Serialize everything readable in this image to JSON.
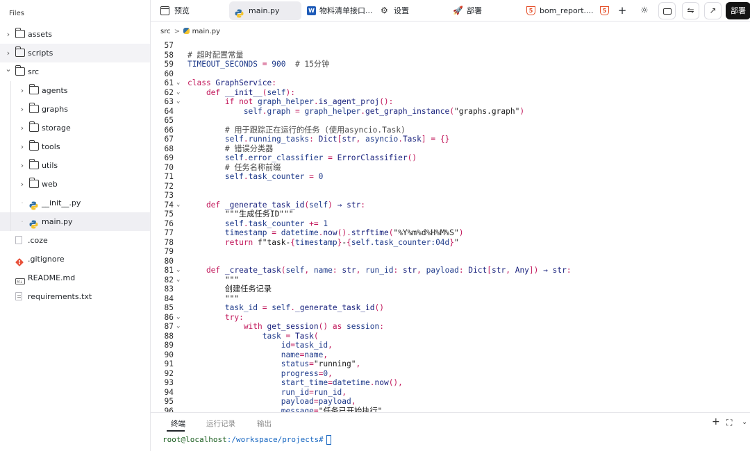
{
  "sidebar": {
    "title": "Files",
    "items": [
      {
        "label": "assets",
        "type": "folder",
        "depth": 0,
        "expanded": false
      },
      {
        "label": "scripts",
        "type": "folder",
        "depth": 0,
        "expanded": false
      },
      {
        "label": "src",
        "type": "folder",
        "depth": 0,
        "expanded": true
      },
      {
        "label": "agents",
        "type": "folder",
        "depth": 1,
        "expanded": false
      },
      {
        "label": "graphs",
        "type": "folder",
        "depth": 1,
        "expanded": false
      },
      {
        "label": "storage",
        "type": "folder",
        "depth": 1,
        "expanded": false
      },
      {
        "label": "tools",
        "type": "folder",
        "depth": 1,
        "expanded": false
      },
      {
        "label": "utils",
        "type": "folder",
        "depth": 1,
        "expanded": false
      },
      {
        "label": "web",
        "type": "folder",
        "depth": 1,
        "expanded": false
      },
      {
        "label": "__init__.py",
        "type": "python",
        "depth": 1
      },
      {
        "label": "main.py",
        "type": "python",
        "depth": 1
      },
      {
        "label": ".coze",
        "type": "file",
        "depth": 0
      },
      {
        "label": ".gitignore",
        "type": "git",
        "depth": 0
      },
      {
        "label": "README.md",
        "type": "markdown",
        "depth": 0
      },
      {
        "label": "requirements.txt",
        "type": "text",
        "depth": 0
      }
    ]
  },
  "tabs": [
    {
      "label": "预览",
      "icon": "preview-icon"
    },
    {
      "label": "main.py",
      "icon": "python-icon",
      "active": true
    },
    {
      "label": "物料清单接口...",
      "icon": "word-icon"
    },
    {
      "label": "设置",
      "icon": "settings-sliders-icon"
    },
    {
      "label": "部署",
      "icon": "rocket-icon"
    },
    {
      "label": "bom_report....",
      "icon": "html5-icon"
    }
  ],
  "toolbar": {
    "add": "+",
    "deploy": "部署"
  },
  "breadcrumb": {
    "root": "src",
    "sep": ">",
    "file": "main.py"
  },
  "code_lines": [
    {
      "n": 57,
      "fold": "",
      "parts": []
    },
    {
      "n": 58,
      "fold": "",
      "parts": [
        [
          "# 超时配置常量",
          "com"
        ]
      ]
    },
    {
      "n": 59,
      "fold": "",
      "parts": [
        [
          "TIMEOUT_SECONDS",
          "var"
        ],
        [
          " = ",
          "pun"
        ],
        [
          "900",
          "num"
        ],
        [
          "  # 15分钟",
          "com"
        ]
      ]
    },
    {
      "n": 60,
      "fold": "",
      "parts": []
    },
    {
      "n": 61,
      "fold": "v",
      "parts": [
        [
          "class ",
          "kw"
        ],
        [
          "GraphService",
          "cls"
        ],
        [
          ":",
          "pun"
        ]
      ]
    },
    {
      "n": 62,
      "fold": "v",
      "parts": [
        [
          "    def ",
          "kw"
        ],
        [
          "__init__",
          "fn"
        ],
        [
          "(",
          "pun"
        ],
        [
          "self",
          "p"
        ],
        [
          "):",
          "pun"
        ]
      ]
    },
    {
      "n": 63,
      "fold": "v",
      "parts": [
        [
          "        if not ",
          "kw"
        ],
        [
          "graph_helper",
          "var"
        ],
        [
          ".",
          "pun"
        ],
        [
          "is_agent_proj",
          "fn"
        ],
        [
          "():",
          "pun"
        ]
      ]
    },
    {
      "n": 64,
      "fold": "",
      "parts": [
        [
          "            self",
          "p"
        ],
        [
          ".",
          "pun"
        ],
        [
          "graph",
          "var"
        ],
        [
          " = ",
          "pun"
        ],
        [
          "graph_helper",
          "var"
        ],
        [
          ".",
          "pun"
        ],
        [
          "get_graph_instance",
          "fn"
        ],
        [
          "(",
          "pun"
        ],
        [
          "\"graphs.graph\"",
          "str"
        ],
        [
          ")",
          "pun"
        ]
      ]
    },
    {
      "n": 65,
      "fold": "",
      "parts": []
    },
    {
      "n": 66,
      "fold": "",
      "parts": [
        [
          "        # 用于跟踪正在运行的任务 (使用asyncio.Task)",
          "com"
        ]
      ]
    },
    {
      "n": 67,
      "fold": "",
      "parts": [
        [
          "        self",
          "p"
        ],
        [
          ".",
          "pun"
        ],
        [
          "running_tasks",
          "var"
        ],
        [
          ": ",
          "pun"
        ],
        [
          "Dict",
          "cls"
        ],
        [
          "[",
          "pun"
        ],
        [
          "str",
          "cls"
        ],
        [
          ", ",
          "pun"
        ],
        [
          "asyncio",
          "var"
        ],
        [
          ".",
          "pun"
        ],
        [
          "Task",
          "cls"
        ],
        [
          "] = {}",
          "pun"
        ]
      ]
    },
    {
      "n": 68,
      "fold": "",
      "parts": [
        [
          "        # 错误分类器",
          "com"
        ]
      ]
    },
    {
      "n": 69,
      "fold": "",
      "parts": [
        [
          "        self",
          "p"
        ],
        [
          ".",
          "pun"
        ],
        [
          "error_classifier",
          "var"
        ],
        [
          " = ",
          "pun"
        ],
        [
          "ErrorClassifier",
          "cls"
        ],
        [
          "()",
          "pun"
        ]
      ]
    },
    {
      "n": 70,
      "fold": "",
      "parts": [
        [
          "        # 任务名称前缀",
          "com"
        ]
      ]
    },
    {
      "n": 71,
      "fold": "",
      "parts": [
        [
          "        self",
          "p"
        ],
        [
          ".",
          "pun"
        ],
        [
          "task_counter",
          "var"
        ],
        [
          " = ",
          "pun"
        ],
        [
          "0",
          "num"
        ]
      ]
    },
    {
      "n": 72,
      "fold": "",
      "parts": []
    },
    {
      "n": 73,
      "fold": "",
      "parts": []
    },
    {
      "n": 74,
      "fold": "v",
      "parts": [
        [
          "    def ",
          "kw"
        ],
        [
          "_generate_task_id",
          "fn"
        ],
        [
          "(",
          "pun"
        ],
        [
          "self",
          "p"
        ],
        [
          ") ",
          "pun"
        ],
        [
          "→",
          "cls"
        ],
        [
          " str",
          "cls"
        ],
        [
          ":",
          "pun"
        ]
      ]
    },
    {
      "n": 75,
      "fold": "",
      "parts": [
        [
          "        \"\"\"生成任务ID\"\"\"",
          "str"
        ]
      ]
    },
    {
      "n": 76,
      "fold": "",
      "parts": [
        [
          "        self",
          "p"
        ],
        [
          ".",
          "pun"
        ],
        [
          "task_counter",
          "var"
        ],
        [
          " += ",
          "pun"
        ],
        [
          "1",
          "num"
        ]
      ]
    },
    {
      "n": 77,
      "fold": "",
      "parts": [
        [
          "        timestamp",
          "var"
        ],
        [
          " = ",
          "pun"
        ],
        [
          "datetime",
          "var"
        ],
        [
          ".",
          "pun"
        ],
        [
          "now",
          "fn"
        ],
        [
          "().",
          "pun"
        ],
        [
          "strftime",
          "fn"
        ],
        [
          "(",
          "pun"
        ],
        [
          "\"%Y%m%d%H%M%S\"",
          "str"
        ],
        [
          ")",
          "pun"
        ]
      ]
    },
    {
      "n": 78,
      "fold": "",
      "parts": [
        [
          "        return ",
          "kw"
        ],
        [
          "f\"task-",
          "str"
        ],
        [
          "{",
          "pun"
        ],
        [
          "timestamp",
          "var"
        ],
        [
          "}",
          "pun"
        ],
        [
          "-",
          "str"
        ],
        [
          "{",
          "pun"
        ],
        [
          "self.task_counter:04d",
          "var"
        ],
        [
          "}",
          "pun"
        ],
        [
          "\"",
          "str"
        ]
      ]
    },
    {
      "n": 79,
      "fold": "",
      "parts": []
    },
    {
      "n": 80,
      "fold": "",
      "parts": []
    },
    {
      "n": 81,
      "fold": "v",
      "parts": [
        [
          "    def ",
          "kw"
        ],
        [
          "_create_task",
          "fn"
        ],
        [
          "(",
          "pun"
        ],
        [
          "self",
          "p"
        ],
        [
          ", ",
          "pun"
        ],
        [
          "name",
          "var"
        ],
        [
          ": ",
          "pun"
        ],
        [
          "str",
          "cls"
        ],
        [
          ", ",
          "pun"
        ],
        [
          "run_id",
          "var"
        ],
        [
          ": ",
          "pun"
        ],
        [
          "str",
          "cls"
        ],
        [
          ", ",
          "pun"
        ],
        [
          "payload",
          "var"
        ],
        [
          ": ",
          "pun"
        ],
        [
          "Dict",
          "cls"
        ],
        [
          "[",
          "pun"
        ],
        [
          "str",
          "cls"
        ],
        [
          ", ",
          "pun"
        ],
        [
          "Any",
          "cls"
        ],
        [
          "]) ",
          "pun"
        ],
        [
          "→",
          "cls"
        ],
        [
          " str",
          "cls"
        ],
        [
          ":",
          "pun"
        ]
      ]
    },
    {
      "n": 82,
      "fold": "v",
      "parts": [
        [
          "        \"\"\"",
          "str"
        ]
      ]
    },
    {
      "n": 83,
      "fold": "",
      "parts": [
        [
          "        创建任务记录",
          "str"
        ]
      ]
    },
    {
      "n": 84,
      "fold": "",
      "parts": [
        [
          "        \"\"\"",
          "str"
        ]
      ]
    },
    {
      "n": 85,
      "fold": "",
      "parts": [
        [
          "        task_id",
          "var"
        ],
        [
          " = ",
          "pun"
        ],
        [
          "self",
          "p"
        ],
        [
          ".",
          "pun"
        ],
        [
          "_generate_task_id",
          "fn"
        ],
        [
          "()",
          "pun"
        ]
      ]
    },
    {
      "n": 86,
      "fold": "v",
      "parts": [
        [
          "        try",
          "kw"
        ],
        [
          ":",
          "pun"
        ]
      ]
    },
    {
      "n": 87,
      "fold": "v",
      "parts": [
        [
          "            with ",
          "kw"
        ],
        [
          "get_session",
          "fn"
        ],
        [
          "() ",
          "pun"
        ],
        [
          "as ",
          "kw"
        ],
        [
          "session",
          "var"
        ],
        [
          ":",
          "pun"
        ]
      ]
    },
    {
      "n": 88,
      "fold": "",
      "parts": [
        [
          "                task",
          "var"
        ],
        [
          " = ",
          "pun"
        ],
        [
          "Task",
          "cls"
        ],
        [
          "(",
          "pun"
        ]
      ]
    },
    {
      "n": 89,
      "fold": "",
      "parts": [
        [
          "                    id",
          "var"
        ],
        [
          "=",
          "pun"
        ],
        [
          "task_id",
          "var"
        ],
        [
          ",",
          "pun"
        ]
      ]
    },
    {
      "n": 90,
      "fold": "",
      "parts": [
        [
          "                    name",
          "var"
        ],
        [
          "=",
          "pun"
        ],
        [
          "name",
          "var"
        ],
        [
          ",",
          "pun"
        ]
      ]
    },
    {
      "n": 91,
      "fold": "",
      "parts": [
        [
          "                    status",
          "var"
        ],
        [
          "=",
          "pun"
        ],
        [
          "\"running\"",
          "str"
        ],
        [
          ",",
          "pun"
        ]
      ]
    },
    {
      "n": 92,
      "fold": "",
      "parts": [
        [
          "                    progress",
          "var"
        ],
        [
          "=",
          "pun"
        ],
        [
          "0",
          "num"
        ],
        [
          ",",
          "pun"
        ]
      ]
    },
    {
      "n": 93,
      "fold": "",
      "parts": [
        [
          "                    start_time",
          "var"
        ],
        [
          "=",
          "pun"
        ],
        [
          "datetime",
          "var"
        ],
        [
          ".",
          "pun"
        ],
        [
          "now",
          "fn"
        ],
        [
          "(),",
          "pun"
        ]
      ]
    },
    {
      "n": 94,
      "fold": "",
      "parts": [
        [
          "                    run_id",
          "var"
        ],
        [
          "=",
          "pun"
        ],
        [
          "run_id",
          "var"
        ],
        [
          ",",
          "pun"
        ]
      ]
    },
    {
      "n": 95,
      "fold": "",
      "parts": [
        [
          "                    payload",
          "var"
        ],
        [
          "=",
          "pun"
        ],
        [
          "payload",
          "var"
        ],
        [
          ",",
          "pun"
        ]
      ]
    },
    {
      "n": 96,
      "fold": "",
      "parts": [
        [
          "                    message",
          "var"
        ],
        [
          "=",
          "pun"
        ],
        [
          "\"任务已开始执行\"",
          "str"
        ]
      ]
    }
  ],
  "panel": {
    "tabs": [
      "终端",
      "运行记录",
      "输出"
    ],
    "add": "+",
    "prompt_user": "root@localhost",
    "prompt_path": ":/workspace/projects#"
  }
}
